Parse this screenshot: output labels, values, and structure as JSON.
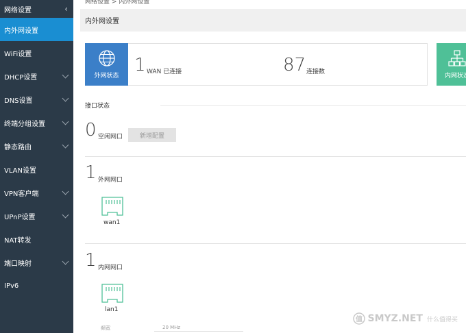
{
  "sidebar": {
    "header": "网络设置",
    "items": [
      {
        "label": "内外网设置",
        "active": true,
        "expandable": false
      },
      {
        "label": "WiFi设置",
        "active": false,
        "expandable": false
      },
      {
        "label": "DHCP设置",
        "active": false,
        "expandable": true
      },
      {
        "label": "DNS设置",
        "active": false,
        "expandable": true
      },
      {
        "label": "终端分组设置",
        "active": false,
        "expandable": true
      },
      {
        "label": "静态路由",
        "active": false,
        "expandable": true
      },
      {
        "label": "VLAN设置",
        "active": false,
        "expandable": false
      },
      {
        "label": "VPN客户端",
        "active": false,
        "expandable": true
      },
      {
        "label": "UPnP设置",
        "active": false,
        "expandable": true
      },
      {
        "label": "NAT转发",
        "active": false,
        "expandable": false
      },
      {
        "label": "端口映射",
        "active": false,
        "expandable": true
      },
      {
        "label": "IPv6",
        "active": false,
        "expandable": false
      }
    ]
  },
  "breadcrumb": "网络设置 > 内外网设置",
  "page_title": "内外网设置",
  "summary": {
    "ext_tile_label": "外网状态",
    "int_tile_label": "内网状态",
    "wan_count": "1",
    "wan_text": "WAN 已连接",
    "conn_count": "87",
    "conn_text": "连接数"
  },
  "interface": {
    "section_title": "接口状态",
    "idle_count": "0",
    "idle_label": "空闲网口",
    "add_button": "新增配置",
    "wan_group": {
      "count": "1",
      "label": "外网网口",
      "ports": [
        "wan1"
      ]
    },
    "lan_group": {
      "count": "1",
      "label": "内网网口",
      "ports": [
        "lan1"
      ]
    }
  },
  "bottom": {
    "field_label": "频宽",
    "field_value": "20 MHz"
  },
  "watermark": {
    "text": "SMYZ.NET",
    "sub": "什么值得买"
  },
  "colors": {
    "sidebar_bg": "#2b3a48",
    "active_item": "#1a8ed2",
    "ext_tile": "#3b7fc8",
    "int_tile": "#4fc097",
    "port_icon": "#4fc097"
  }
}
